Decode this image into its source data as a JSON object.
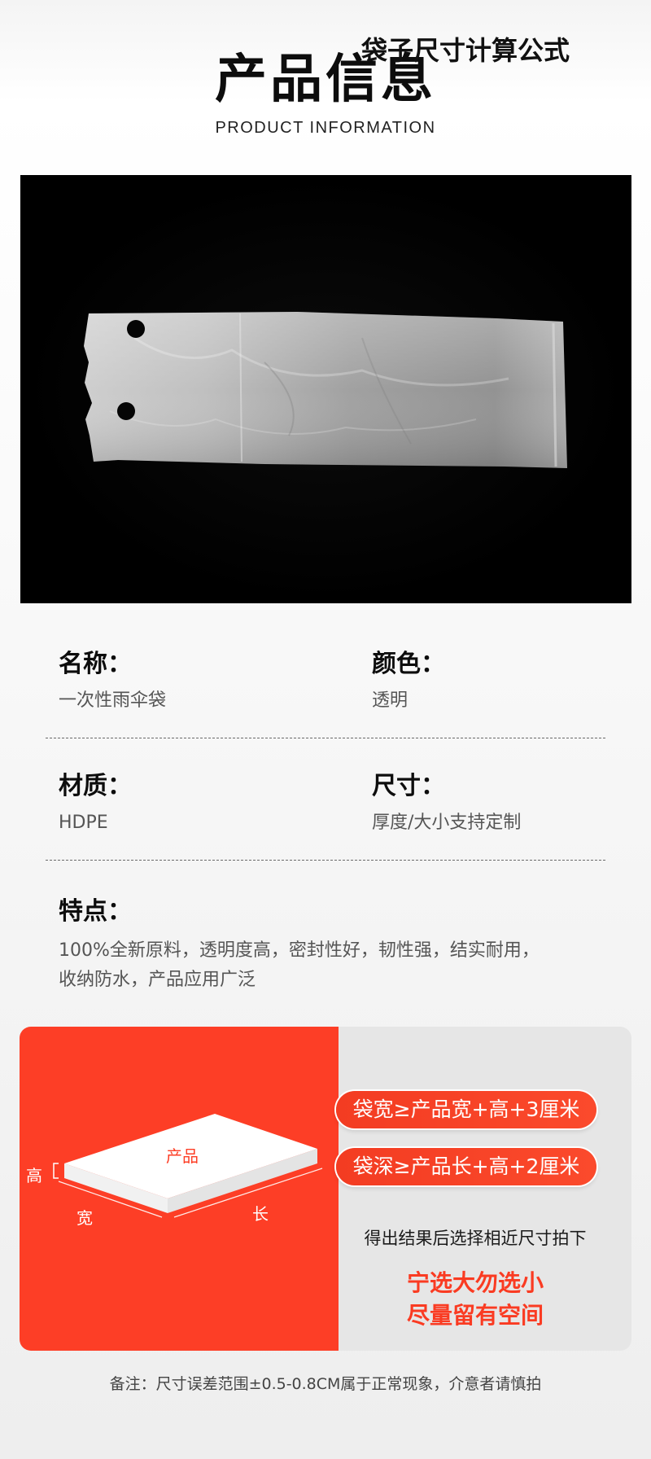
{
  "header": {
    "title": "产品信息",
    "subtitle": "PRODUCT INFORMATION"
  },
  "info": {
    "name": {
      "label": "名称：",
      "value": "一次性雨伞袋"
    },
    "color": {
      "label": "颜色：",
      "value": "透明"
    },
    "material": {
      "label": "材质：",
      "value": "HDPE"
    },
    "size": {
      "label": "尺寸：",
      "value": "厚度/大小支持定制"
    },
    "features": {
      "label": "特点：",
      "line1": "100%全新原料，透明度高，密封性好，韧性强，结实耐用，",
      "line2": "收纳防水，产品应用广泛"
    }
  },
  "formula": {
    "title": "袋子尺寸计算公式",
    "width_rule": "袋宽≥产品宽+高+3厘米",
    "depth_rule": "袋深≥产品长+高+2厘米",
    "instruction": "得出结果后选择相近尺寸拍下",
    "slogan_line1": "宁选大勿选小",
    "slogan_line2": "尽量留有空间",
    "diagram": {
      "product_label": "产品",
      "height_label": "高",
      "width_label": "宽",
      "length_label": "长"
    },
    "colors": {
      "accent": "#fd3e26",
      "panel": "#e6e6e6"
    }
  },
  "footer": {
    "note": "备注：尺寸误差范围±0.5-0.8CM属于正常现象，介意者请慎拍"
  }
}
